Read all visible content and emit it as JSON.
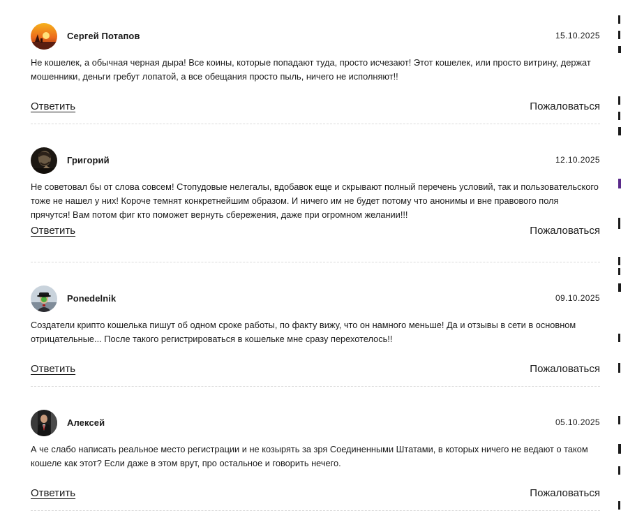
{
  "comments": [
    {
      "author": "Сергей Потапов",
      "date": "15.10.2025",
      "text": "Не кошелек, а обычная черная дыра! Все коины, которые попадают туда, просто исчезают! Этот кошелек, или просто витрину, держат мошенники, деньги гребут лопатой, а все обещания просто пыль, ничего не исполняют!!",
      "reply_label": "Ответить",
      "report_label": "Пожаловаться",
      "avatar": "sunset-avatar"
    },
    {
      "author": "Григорий",
      "date": "12.10.2025",
      "text": "Не советовал бы от слова совсем! Стопудовые нелегалы, вдобавок еще и скрывают полный перечень условий, так и пользовательского тоже не нашел у них! Короче темнят конкретнейшим образом. И ничего им не будет потому что анонимы и вне правового поля прячутся! Вам потом фиг кто поможет вернуть сбережения, даже при огромном желании!!!",
      "reply_label": "Ответить",
      "report_label": "Пожаловаться",
      "avatar": "dark-portrait-avatar"
    },
    {
      "author": "Ponedelnik",
      "date": "09.10.2025",
      "text": "Создатели крипто кошелька пишут об одном сроке работы, по факту вижу, что он намного меньше! Да и отзывы в сети в основном отрицательные... После такого регистрироваться в кошельке мне сразу перехотелось!!",
      "reply_label": "Ответить",
      "report_label": "Пожаловаться",
      "avatar": "bowler-hat-avatar"
    },
    {
      "author": "Алексей",
      "date": "05.10.2025",
      "text": "А че слабо написать реальное место регистрации и не козырять за зря Соединенными Штатами, в которых ничего не ведают о таком кошеле как этот? Если даже в этом врут, про остальное и говорить нечего.",
      "reply_label": "Ответить",
      "report_label": "Пожаловаться",
      "avatar": "suited-man-avatar"
    }
  ]
}
